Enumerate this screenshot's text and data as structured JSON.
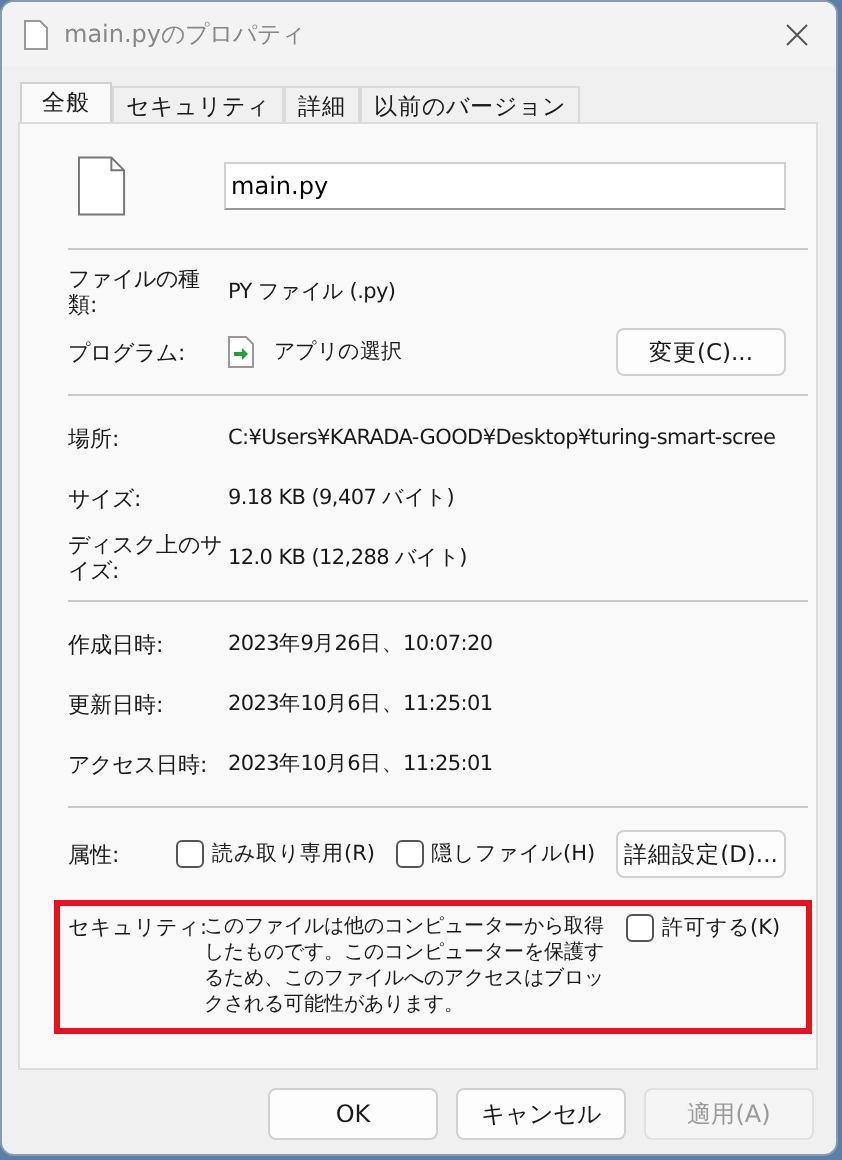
{
  "window": {
    "title": "main.pyのプロパティ"
  },
  "tabs": [
    {
      "label": "全般",
      "selected": true
    },
    {
      "label": "セキュリティ",
      "selected": false
    },
    {
      "label": "詳細",
      "selected": false
    },
    {
      "label": "以前のバージョン",
      "selected": false
    }
  ],
  "file_name": {
    "value": "main.py"
  },
  "sections": [
    [
      {
        "kind": "text",
        "label": "ファイルの種類:",
        "value": "PY ファイル (.py)"
      },
      {
        "kind": "program",
        "label": "プログラム:",
        "value": "アプリの選択",
        "button": "変更(C)..."
      }
    ],
    [
      {
        "kind": "text",
        "label": "場所:",
        "value": "C:¥Users¥KARADA-GOOD¥Desktop¥turing-smart-scree"
      },
      {
        "kind": "text",
        "label": "サイズ:",
        "value": "9.18 KB (9,407 バイト)"
      },
      {
        "kind": "text",
        "label": "ディスク上のサイズ:",
        "value": "12.0 KB (12,288 バイト)"
      }
    ],
    [
      {
        "kind": "text",
        "label": "作成日時:",
        "value": "2023年9月26日、10:07:20"
      },
      {
        "kind": "text",
        "label": "更新日時:",
        "value": "2023年10月6日、11:25:01"
      },
      {
        "kind": "text",
        "label": "アクセス日時:",
        "value": "2023年10月6日、11:25:01"
      }
    ]
  ],
  "attributes": {
    "label": "属性:",
    "checkboxes": [
      {
        "label": "読み取り専用(R)",
        "checked": false
      },
      {
        "label": "隠しファイル(H)",
        "checked": false
      }
    ],
    "button": "詳細設定(D)..."
  },
  "security": {
    "label": "セキュリティ:",
    "text": "このファイルは他のコンピューターから取得したものです。このコンピューターを保護するため、このファイルへのアクセスはブロックされる可能性があります。",
    "checkbox": {
      "label": "許可する(K)",
      "checked": false
    }
  },
  "buttons": [
    {
      "label": "OK",
      "disabled": false
    },
    {
      "label": "キャンセル",
      "disabled": false
    },
    {
      "label": "適用(A)",
      "disabled": true
    }
  ]
}
